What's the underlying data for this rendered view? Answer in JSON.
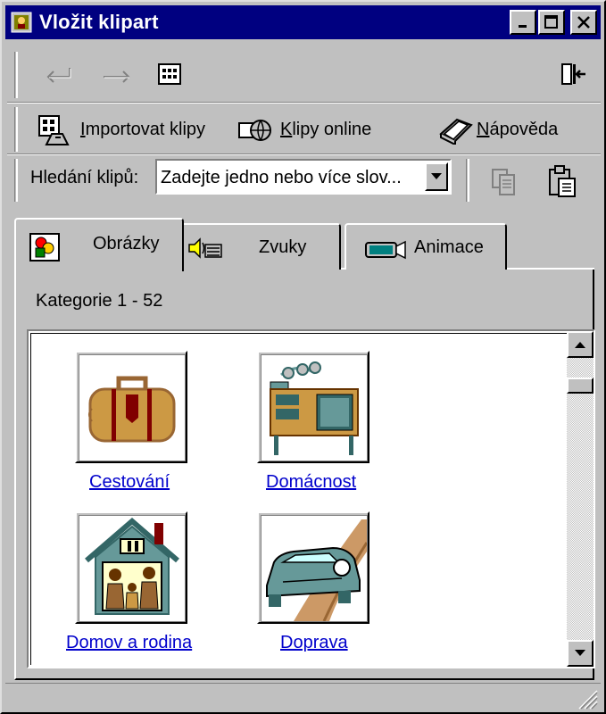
{
  "window": {
    "title": "Vložit klipart"
  },
  "nav_toolbar": {
    "back_icon": "back-arrow-icon",
    "forward_icon": "forward-arrow-icon",
    "view_icon": "grid-view-icon",
    "pane_icon": "change-pane-icon"
  },
  "action_toolbar": {
    "import_label": "Importovat klipy",
    "online_label": "Klipy online",
    "help_label": "Nápověda"
  },
  "search": {
    "label": "Hledání klipů:",
    "value": "Zadejte jedno nebo více slov..."
  },
  "tabs": [
    {
      "label": "Obrázky",
      "icon": "pictures-icon",
      "selected": true
    },
    {
      "label": "Zvuky",
      "icon": "sounds-icon",
      "selected": false
    },
    {
      "label": "Animace",
      "icon": "animation-icon",
      "selected": false
    }
  ],
  "category_range": "Kategorie 1 - 52",
  "categories": [
    {
      "label": "Cestování",
      "icon": "suitcase-icon"
    },
    {
      "label": "Domácnost",
      "icon": "kitchen-icon"
    },
    {
      "label": "Domov a rodina",
      "icon": "house-family-icon"
    },
    {
      "label": "Doprava",
      "icon": "car-road-icon"
    }
  ],
  "colors": {
    "titlebar": "#000080",
    "face": "#c0c0c0",
    "link": "#0000cc"
  }
}
